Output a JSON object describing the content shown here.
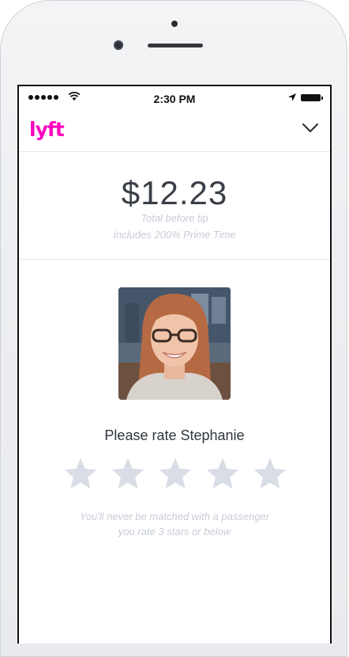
{
  "status_bar": {
    "time": "2:30 PM"
  },
  "header": {
    "logo_text": "lyft",
    "menu_icon": "chevron-down-icon"
  },
  "fare": {
    "amount": "$12.23",
    "label": "Total before tip",
    "note": "Includes 200% Prime Time"
  },
  "rating": {
    "title": "Please rate Stephanie",
    "stars_total": 5,
    "stars_selected": 0,
    "note_line1": "You'll never be matched with a passenger",
    "note_line2": "you rate 3 stars or below"
  },
  "colors": {
    "brand": "#ff00bf",
    "star_empty": "#d8dde6",
    "muted_text": "#c7ccd6"
  }
}
